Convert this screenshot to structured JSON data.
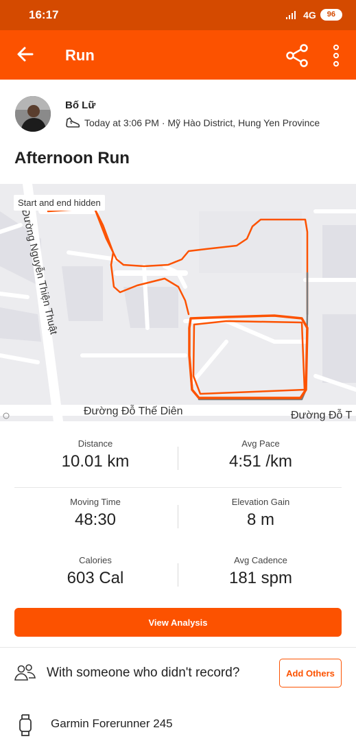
{
  "status_bar": {
    "time": "16:17",
    "network": "4G",
    "battery": "96"
  },
  "app_bar": {
    "title": "Run",
    "icons": [
      "back-arrow-icon",
      "share-icon",
      "more-vertical-icon"
    ]
  },
  "athlete": {
    "name": "Bố Lữ",
    "activity_meta": "Today at 3:06 PM · Mỹ Hào District, Hung Yen Province"
  },
  "activity": {
    "title": "Afternoon Run"
  },
  "map": {
    "badge": "Start and end hidden",
    "street_left": "Đường Nguyễn Thiện Thuật",
    "street_bottom": "Đường Đỗ Thế Diên",
    "street_bottom_right": "Đường Đỗ T",
    "route_color": "#fc5200"
  },
  "stats": {
    "distance_label": "Distance",
    "distance_value": "10.01 km",
    "pace_label": "Avg Pace",
    "pace_value": "4:51 /km",
    "moving_label": "Moving Time",
    "moving_value": "48:30",
    "elevation_label": "Elevation Gain",
    "elevation_value": "8 m",
    "calories_label": "Calories",
    "calories_value": "603 Cal",
    "cadence_label": "Avg Cadence",
    "cadence_value": "181 spm"
  },
  "actions": {
    "view_analysis": "View Analysis",
    "with_someone": "With someone who didn't record?",
    "add_others": "Add Others"
  },
  "device": {
    "name": "Garmin Forerunner 245"
  },
  "colors": {
    "accent": "#fc5200",
    "status_bar": "#d44a00"
  }
}
